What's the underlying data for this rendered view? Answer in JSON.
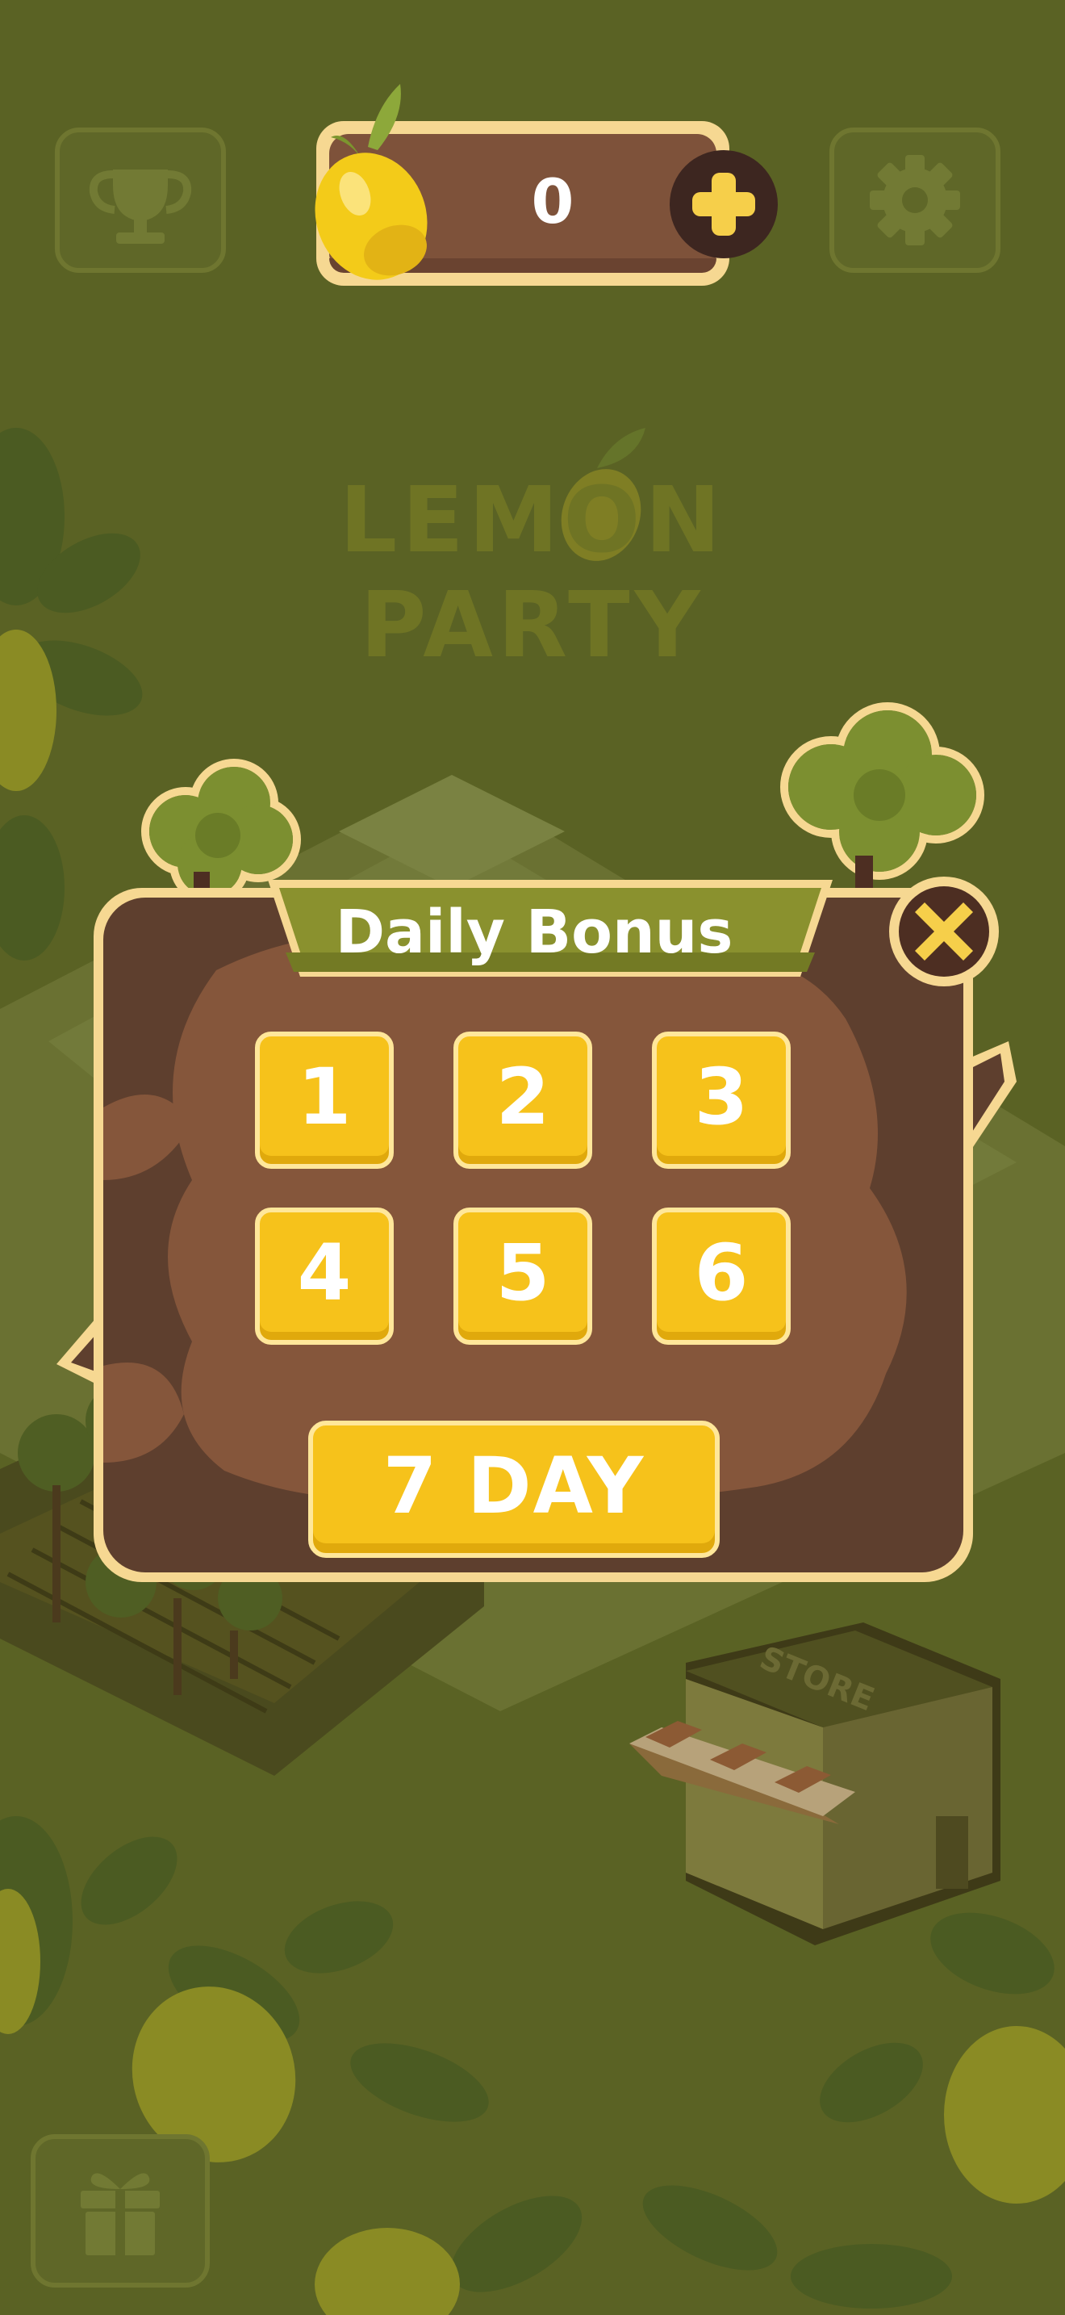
{
  "top_bar": {
    "coin_count": "0",
    "trophy_icon": "trophy-icon",
    "settings_icon": "gear-icon",
    "add_icon": "plus-icon",
    "currency_icon": "lemon-icon"
  },
  "title": {
    "line1": "LEMON",
    "line2": "PARTY"
  },
  "dialog": {
    "title": "Daily Bonus",
    "close_icon": "close-icon",
    "days": [
      "1",
      "2",
      "3",
      "4",
      "5",
      "6"
    ],
    "final_day": "7 DAY"
  },
  "map": {
    "store_sign": "STORE"
  },
  "bottom_bar": {
    "gift_icon": "gift-icon"
  },
  "colors": {
    "overlay_background": "#5a6224",
    "panel_brown": "#5e3f2e",
    "panel_border": "#f6d892",
    "tile_yellow": "#f6c21b",
    "ribbon_green": "#8a912e"
  }
}
